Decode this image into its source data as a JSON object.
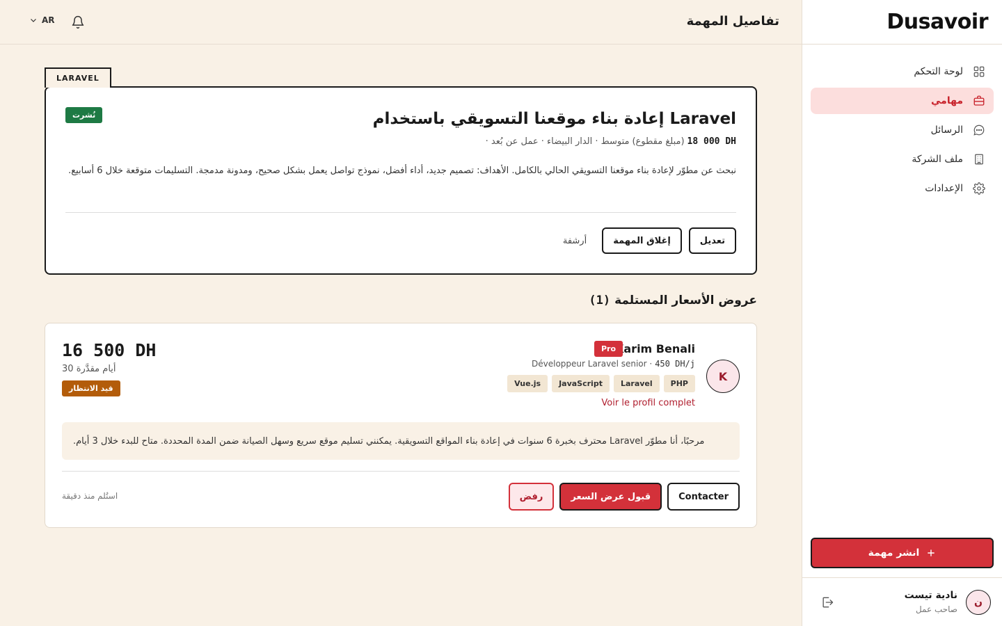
{
  "app": {
    "logo": "Dusavoir"
  },
  "topbar": {
    "title": "تفاصيل المهمة",
    "lang": "AR"
  },
  "sidebar": {
    "items": [
      {
        "label": "لوحة التحكم",
        "icon": "dashboard-icon",
        "active": false
      },
      {
        "label": "مهامي",
        "icon": "briefcase-icon",
        "active": true
      },
      {
        "label": "الرسائل",
        "icon": "chat-icon",
        "active": false
      },
      {
        "label": "ملف الشركة",
        "icon": "building-icon",
        "active": false
      },
      {
        "label": "الإعدادات",
        "icon": "gear-icon",
        "active": false
      }
    ],
    "publish_label": "انشر مهمة",
    "user": {
      "initial": "ن",
      "name": "نادية تيست",
      "role": "صاحب عمل"
    }
  },
  "task": {
    "tag": "LARAVEL",
    "status": "نُشرت",
    "title": "إعادة بناء موقعنا التسويقي باستخدام Laravel",
    "price": "18 000 DH",
    "price_type": "(مبلغ مقطوع)",
    "meta_rest": "· متوسط · الدار البيضاء · عمل عن بُعد",
    "description": "نبحث عن مطوّر لإعادة بناء موقعنا التسويقي الحالي بالكامل. الأهداف: تصميم جديد، أداء أفضل، نموذج تواصل يعمل بشكل صحيح، ومدونة مدمجة. التسليمات متوقعة خلال 6 أسابيع.",
    "actions": {
      "edit": "تعديل",
      "close": "إغلاق المهمة",
      "archive": "أرشفة"
    }
  },
  "offers": {
    "heading": "عروض الأسعار المستلمة",
    "count": "(1)",
    "items": [
      {
        "initial": "K",
        "name": "Karim Benali",
        "badge": "Pro",
        "role": "Développeur Laravel senior ·",
        "rate": "450 DH/j",
        "skills": [
          "PHP",
          "Laravel",
          "JavaScript",
          "Vue.js"
        ],
        "profile_link": "Voir le profil complet",
        "price": "16 500 DH",
        "days": "30 أيام مقدَّرة",
        "status": "قيد الانتظار",
        "message": "مرحبًا، أنا مطوّر Laravel محترف بخبرة 6 سنوات في إعادة بناء المواقع التسويقية. يمكنني تسليم موقع سريع وسهل الصيانة ضمن المدة المحددة. متاح للبدء خلال 3 أيام.",
        "actions": {
          "contact": "Contacter",
          "accept": "قبول عرض السعر",
          "reject": "رفض"
        },
        "received": "استُلم منذ دقيقة"
      }
    ]
  },
  "colors": {
    "accent": "#d3313a",
    "background": "#f9f1e6",
    "success": "#1e7a44",
    "warning": "#b35c0a"
  }
}
